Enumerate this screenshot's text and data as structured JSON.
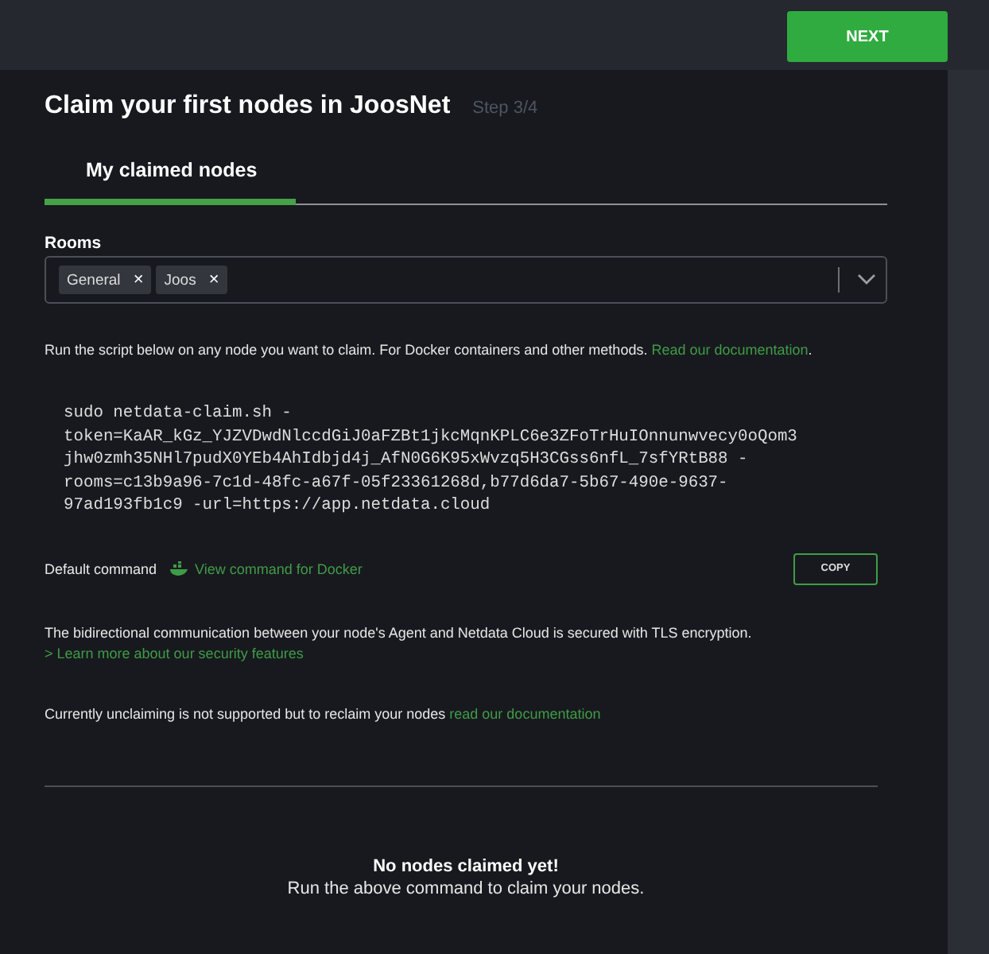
{
  "header": {
    "next_button": "NEXT"
  },
  "title": "Claim your first nodes in JoosNet",
  "step": "Step 3/4",
  "tabs": [
    {
      "label": "My claimed nodes",
      "selected": true
    }
  ],
  "rooms": {
    "label": "Rooms",
    "tags": [
      {
        "label": "General",
        "remove": "×"
      },
      {
        "label": "Joos",
        "remove": "×"
      }
    ]
  },
  "instructions": {
    "text": "Run the script below on any node you want to claim. For Docker containers and other methods. ",
    "link": "Read our documentation",
    "after": "."
  },
  "command_lines": [
    "sudo netdata-claim.sh -",
    "token=KaAR_kGz_YJZVDwdNlccdGiJ0aFZBt1jkcMqnKPLC6e3ZFoTrHuIOnnunwvecy0oQom3",
    "jhw0zmh35NHl7pudX0YEb4AhIdbjd4j_AfN0G6K95xWvzq5H3CGss6nfL_7sfYRtB88 -",
    "rooms=c13b9a96-7c1d-48fc-a67f-05f23361268d,b77d6da7-5b67-490e-9637-",
    "97ad193fb1c9 -url=https://app.netdata.cloud"
  ],
  "command_bar": {
    "label": "Default command",
    "docker_link": "View command for Docker",
    "copy_button": "COPY"
  },
  "security": {
    "text": "The bidirectional communication between your node's Agent and Netdata Cloud is secured with TLS encryption.",
    "link": "> Learn more about our security features"
  },
  "unclaim": {
    "text": "Currently unclaiming is not supported but to reclaim your nodes",
    "link": "read our documentation"
  },
  "empty": {
    "title": "No nodes claimed yet!",
    "text": "Run the above command to claim your nodes."
  }
}
